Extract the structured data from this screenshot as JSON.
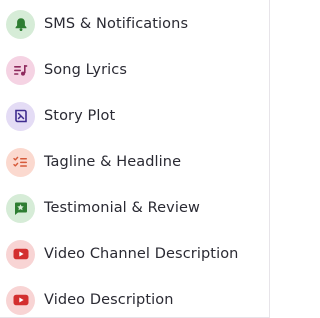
{
  "items": [
    {
      "label": "SMS & Notifications",
      "icon": "bell-icon",
      "bg": "#d6ecd7",
      "fg": "#2e7d32"
    },
    {
      "label": "Song Lyrics",
      "icon": "music-note-icon",
      "bg": "#f5d3e3",
      "fg": "#8e2a5d"
    },
    {
      "label": "Story Plot",
      "icon": "book-icon",
      "bg": "#e4dcf5",
      "fg": "#3f2c8f"
    },
    {
      "label": "Tagline & Headline",
      "icon": "checklist-icon",
      "bg": "#fbd9cf",
      "fg": "#d65a3a"
    },
    {
      "label": "Testimonial & Review",
      "icon": "review-icon",
      "bg": "#d6ecd7",
      "fg": "#2e7d32"
    },
    {
      "label": "Video Channel Description",
      "icon": "youtube-icon",
      "bg": "#f8d4d4",
      "fg": "#d32f2f"
    },
    {
      "label": "Video Description",
      "icon": "youtube-icon",
      "bg": "#f8d4d4",
      "fg": "#d32f2f"
    }
  ]
}
